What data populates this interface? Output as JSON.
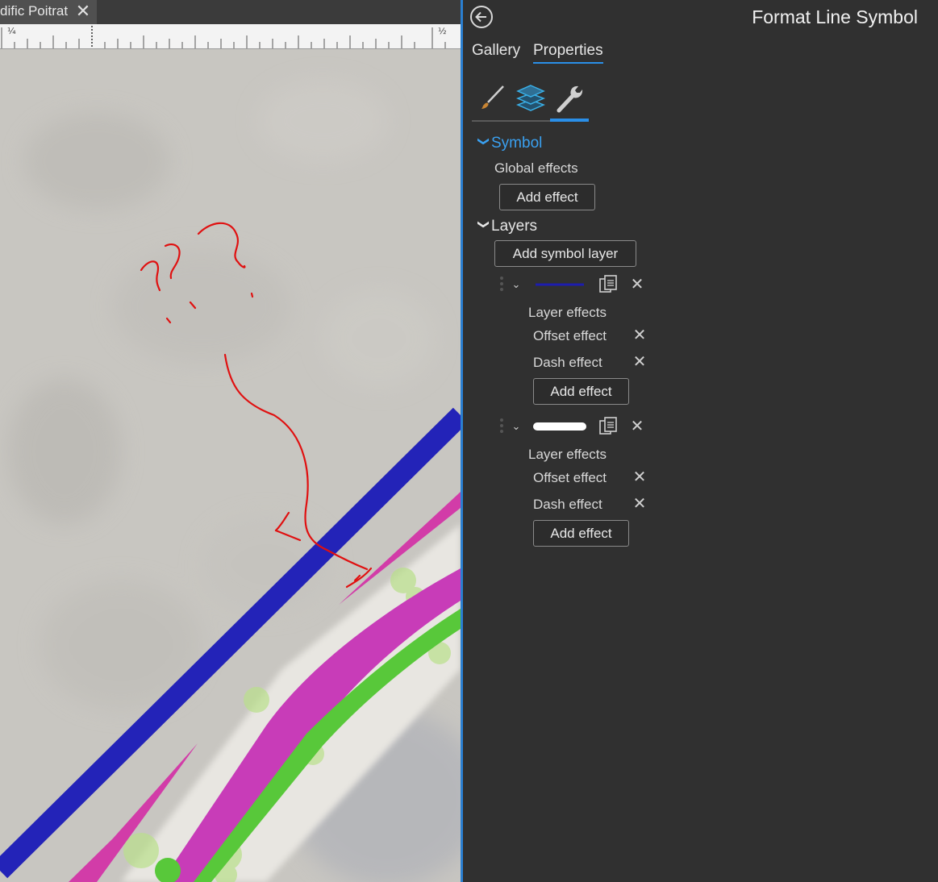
{
  "document_tab": {
    "title": "dific Poitrat",
    "close_glyph": "✕"
  },
  "ruler": {
    "labels": [
      "¼",
      "½"
    ]
  },
  "panel": {
    "title": "Format Line Symbol",
    "tabs": {
      "gallery": "Gallery",
      "properties": "Properties"
    },
    "symbol_section": {
      "heading": "Symbol",
      "global_effects_label": "Global effects",
      "add_effect_button": "Add effect"
    },
    "layers_section": {
      "heading": "Layers",
      "add_symbol_layer_button": "Add symbol layer",
      "layers": [
        {
          "swatch": "blue-line",
          "swatch_color": "#1d1dae",
          "layer_effects_label": "Layer effects",
          "effects": [
            "Offset effect",
            "Dash effect"
          ],
          "add_effect_button": "Add effect"
        },
        {
          "swatch": "white-line",
          "swatch_color": "#ffffff",
          "layer_effects_label": "Layer effects",
          "effects": [
            "Offset effect",
            "Dash effect"
          ],
          "add_effect_button": "Add effect"
        }
      ]
    }
  },
  "colors": {
    "accent": "#2a8fe8",
    "panel_bg": "#303030",
    "map_blue_line": "#2323b8",
    "map_magenta": "#d23ca8",
    "map_purple": "#b53fd0",
    "map_green": "#58c83a",
    "annotation_red": "#e01010"
  },
  "icons": [
    "back-arrow-icon",
    "close-icon",
    "paintbrush-icon",
    "layers-icon",
    "wrench-icon",
    "chevron-down-icon",
    "copy-icon",
    "drag-grip-icon"
  ]
}
